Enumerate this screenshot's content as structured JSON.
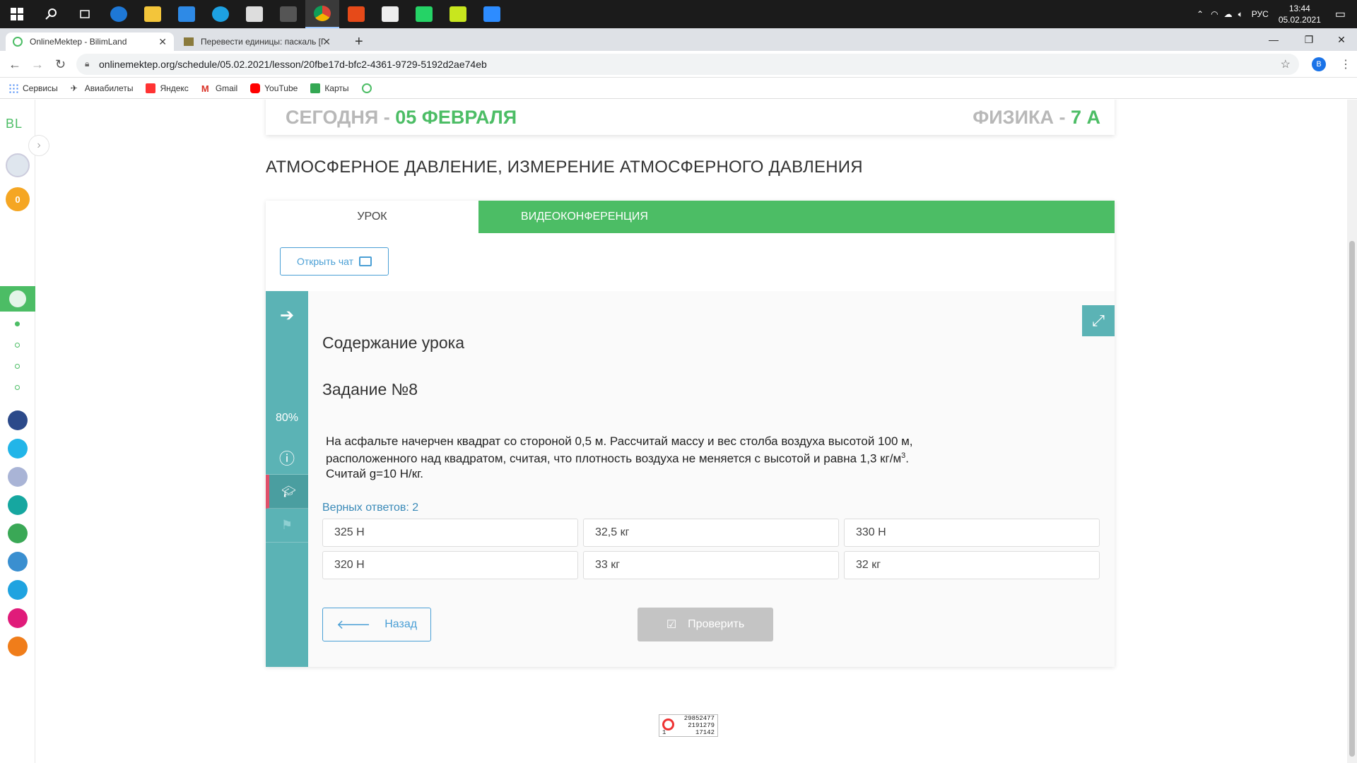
{
  "taskbar": {
    "clock_time": "13:44",
    "clock_date": "05.02.2021",
    "lang": "РУС"
  },
  "browser": {
    "tabs": [
      {
        "title": "OnlineMektep - BilimLand"
      },
      {
        "title": "Перевести единицы: паскаль [П"
      }
    ],
    "new_tab": "+",
    "url": "onlinemektep.org/schedule/05.02.2021/lesson/20fbe17d-bfc2-4361-9729-5192d2ae74eb",
    "profile_initial": "B",
    "bookmarks": [
      "Сервисы",
      "Авиабилеты",
      "Яндекс",
      "Gmail",
      "YouTube",
      "Карты"
    ]
  },
  "sidebar": {
    "logo": "BL",
    "coins": "0"
  },
  "header": {
    "today_label": "СЕГОДНЯ - ",
    "today_date": "05 ФЕВРАЛЯ",
    "subject": "ФИЗИКА - ",
    "class": "7 А"
  },
  "lesson": {
    "title": "АТМОСФЕРНОЕ ДАВЛЕНИЕ, ИЗМЕРЕНИЕ АТМОСФЕРНОГО ДАВЛЕНИЯ",
    "tab_lesson": "УРОК",
    "tab_video": "ВИДЕОКОНФЕРЕНЦИЯ",
    "open_chat": "Открыть чат",
    "progress": "80%",
    "content_heading": "Содержание урока",
    "task_heading": "Задание №8",
    "task_text_1": "На асфальте начерчен квадрат со стороной 0,5 м. Рассчитай массу и вес столба воздуха высотой 100 м, расположенного над квадратом, считая, что плотность воздуха не меняется с высотой и равна 1,3 кг/м",
    "task_sup": "3",
    "task_text_2": ".  Считай g=10 Н/кг.",
    "correct_answers": "Верных ответов: 2",
    "answers": [
      "325 Н",
      "32,5 кг",
      "330 Н",
      "320 Н",
      "33 кг",
      "32 кг"
    ],
    "back_button": "Назад",
    "check_button": "Проверить"
  },
  "counter": {
    "line1": "29852477",
    "line2": "2191279",
    "line3": "17142",
    "left_num": "1"
  }
}
